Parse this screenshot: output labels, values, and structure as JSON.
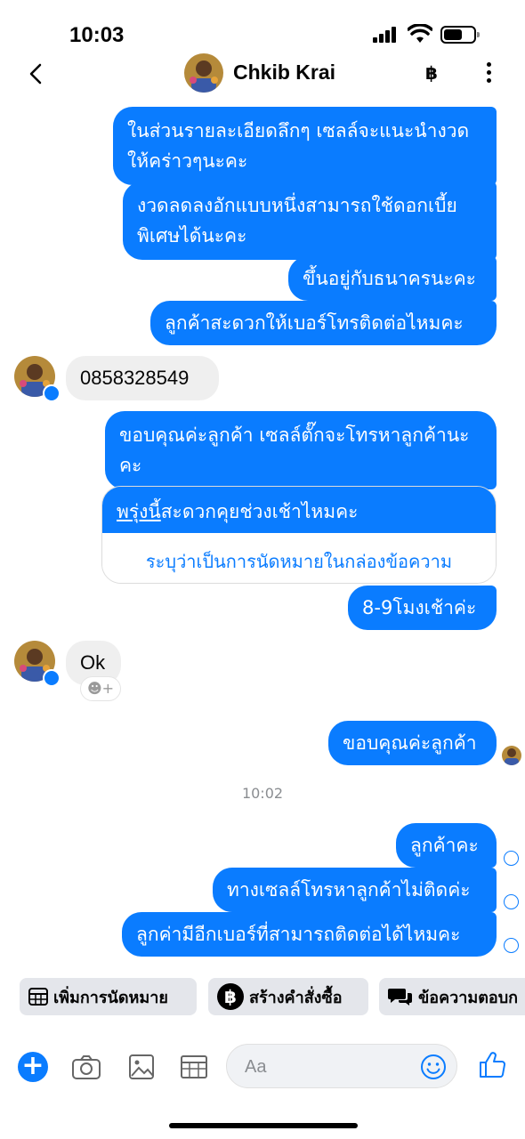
{
  "status_bar": {
    "time": "10:03"
  },
  "header": {
    "contact_name": "Chkib Krai",
    "order_icon": "baht-icon",
    "more_icon": "more-vertical-icon"
  },
  "messages": [
    {
      "dir": "out",
      "text": "ในส่วนรายละเอียดลึกๆ เซลล์จะแนะนำงวดให้คร่าวๆนะคะ"
    },
    {
      "dir": "out",
      "text": "งวดลดลงอักแบบหนึ่งสามารถใช้ดอกเบี้ยพิเศษได้นะคะ"
    },
    {
      "dir": "out",
      "text": "ขึ้นอยู่กับธนาครนะคะ"
    },
    {
      "dir": "out",
      "text": "ลูกค้าสะดวกให้เบอร์โทรติดต่อไหมคะ"
    },
    {
      "dir": "in",
      "text": "0858328549"
    },
    {
      "dir": "out",
      "text": "ขอบคุณค่ะลูกค้า เซลล์ตั๊กจะโทรหาลูกค้านะคะ"
    },
    {
      "dir": "out",
      "text": "8-9โมงเช้าค่ะ"
    },
    {
      "dir": "in",
      "text": "Ok"
    },
    {
      "dir": "out",
      "text": "ขอบคุณค่ะลูกค้า"
    },
    {
      "dir": "out",
      "text": "ลูกค้าคะ"
    },
    {
      "dir": "out",
      "text": "ทางเซลล์โทรหาลูกค้าไม่ติดค่ะ"
    },
    {
      "dir": "out",
      "text": "ลูกค่ามีอีกเบอร์ที่สามารถติดต่อได้ไหมคะ"
    }
  ],
  "appointment_card": {
    "underlined": "พรุ่งนี้",
    "question_rest": "สะดวกคุยช่วงเช้าไหมคะ",
    "action": "ระบุว่าเป็นการนัดหมายในกล่องข้อความ"
  },
  "reaction_button": "☻+",
  "timestamp": "10:02",
  "quick_actions": [
    {
      "label": "เพิ่มการนัดหมาย",
      "icon": "calendar-icon"
    },
    {
      "label": "สร้างคำสั่งซื้อ",
      "icon": "baht-icon"
    },
    {
      "label": "ข้อความตอบก",
      "icon": "chat-bubbles-icon"
    }
  ],
  "composer": {
    "placeholder": "Aa"
  },
  "colors": {
    "accent": "#0a7cff",
    "incoming": "#efefef"
  }
}
